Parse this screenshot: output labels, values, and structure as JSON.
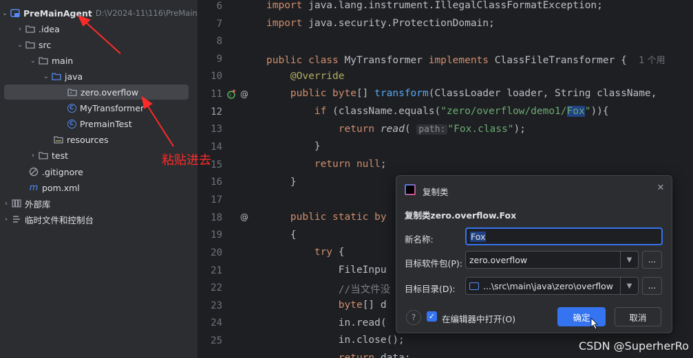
{
  "tree": {
    "root": {
      "name": "PreMainAgent",
      "path": "D:\\V2024-11\\116\\PreMainA"
    },
    "idea": ".idea",
    "src": "src",
    "main": "main",
    "java": "java",
    "package": "zero.overflow",
    "class1": "MyTransformer",
    "class2": "PremainTest",
    "resources": "resources",
    "test": "test",
    "gitignore": ".gitignore",
    "pom": "pom.xml",
    "ext_libs": "外部库",
    "scratches": "临时文件和控制台"
  },
  "editor": {
    "line_numbers": [
      "6",
      "7",
      "8",
      "9",
      "10",
      "11",
      "12",
      "13",
      "14",
      "15",
      "16",
      "17",
      "18",
      "19",
      "20",
      "21",
      "22",
      "23",
      "24",
      "25"
    ],
    "current_line": "12",
    "usage_hint": "1 个用",
    "param_hint": "path:"
  },
  "dialog": {
    "title": "复制类",
    "heading": "复制类zero.overflow.Fox",
    "name_label": "新名称:",
    "name_value": "Fox",
    "package_label": "目标软件包(P):",
    "package_value": "zero.overflow",
    "dir_label": "目标目录(D):",
    "dir_value": "...\\src\\main\\java\\zero\\overflow",
    "more": "...",
    "help": "?",
    "open_in_editor": "在编辑器中打开(O)",
    "ok": "确定",
    "cancel": "取消"
  },
  "annotation": {
    "note": "粘贴进去",
    "color": "#ff2a2a"
  },
  "watermark": "CSDN @SuperherRo"
}
